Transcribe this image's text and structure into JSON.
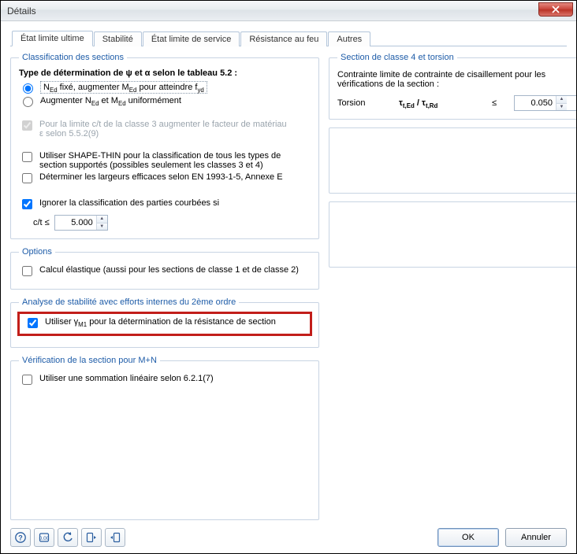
{
  "window": {
    "title": "Détails"
  },
  "tabs": {
    "ultimate": "État limite ultime",
    "stability": "Stabilité",
    "service": "État limite de service",
    "fire": "Résistance au feu",
    "other": "Autres"
  },
  "classification": {
    "legend": "Classification des sections",
    "typeLabel": "Type de détermination de ψ et α selon le tableau 5.2 :",
    "radio1_pre": "N",
    "radio1_sub1": "Ed",
    "radio1_mid1": " fixé, augmenter M",
    "radio1_sub2": "Ed",
    "radio1_mid2": " pour atteindre f",
    "radio1_sub3": "yd",
    "radio2_pre": "Augmenter  N",
    "radio2_sub1": "Ed",
    "radio2_mid": " et M",
    "radio2_sub2": "Ed",
    "radio2_end": " uniformément",
    "disabledCheck": "Pour la limite c/t de la classe 3 augmenter le facteur de matériau ε selon 5.5.2(9)",
    "shapeThin": "Utiliser SHAPE-THIN pour la classification de tous les types de section supportés (possibles seulement les classes 3 et 4)",
    "effWidths": "Déterminer les largeurs efficaces selon EN 1993-1-5, Annexe E",
    "ignoreCurved": "Ignorer la classification des parties courbées si",
    "ctLabel": "c/t ≤",
    "ctValue": "5.000"
  },
  "options": {
    "legend": "Options",
    "elastic": "Calcul élastique (aussi pour les sections de classe 1 et de classe 2)"
  },
  "stabilityGroup": {
    "legend": "Analyse de stabilité avec efforts internes du 2ème ordre",
    "gamma_pre": "Utiliser γ",
    "gamma_sub": "M1",
    "gamma_post": " pour la détermination de la résistance de section"
  },
  "mplusn": {
    "legend": "Vérification de la section pour M+N",
    "linear": "Utiliser une sommation linéaire selon 6.2.1(7)"
  },
  "class4": {
    "legend": "Section de classe 4 et torsion",
    "desc": "Contrainte limite de contrainte de cisaillement pour les vérifications de la section :",
    "torsionLabel": "Torsion",
    "formula_pre": "τ",
    "formula_sub1": "t,Ed",
    "formula_mid": " / τ",
    "formula_sub2": "t,Rd",
    "leq": "≤",
    "value": "0.050"
  },
  "buttons": {
    "ok": "OK",
    "cancel": "Annuler"
  }
}
